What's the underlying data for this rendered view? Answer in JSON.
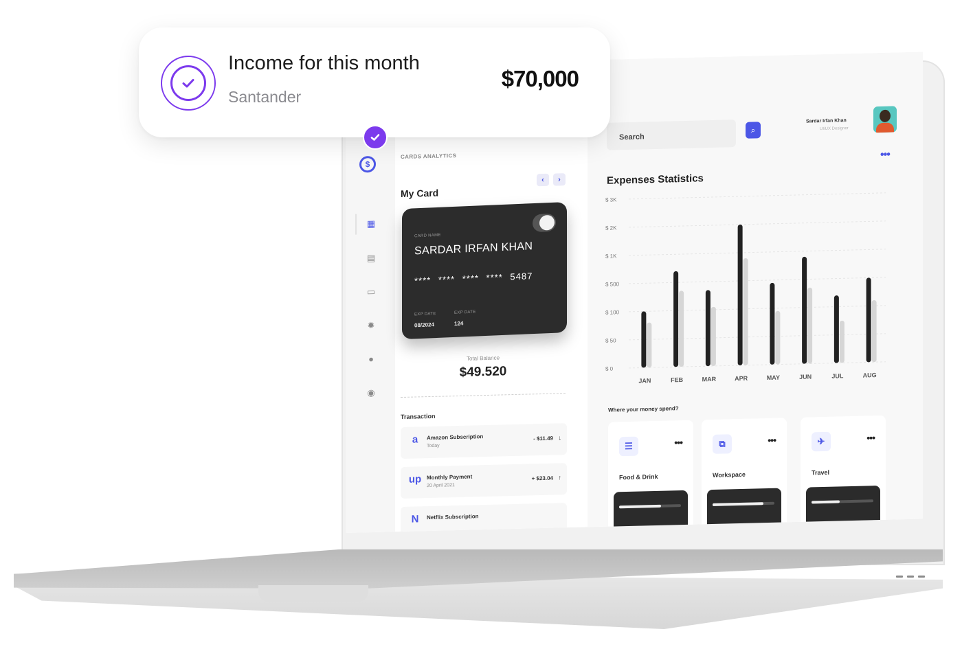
{
  "income_card": {
    "title": "Income for this month",
    "bank": "Santander",
    "amount": "$70,000"
  },
  "sidebar": {
    "icons": [
      "dashboard-icon",
      "calendar-icon",
      "chat-icon",
      "settings-icon",
      "user-icon",
      "help-icon"
    ]
  },
  "cards": {
    "section_label": "CARDS ANALYTICS",
    "title": "My Card",
    "prev": "‹",
    "next": "›",
    "card": {
      "name_label": "CARD NAME",
      "holder": "SARDAR IRFAN KHAN",
      "number": "**** **** **** **** 5487",
      "exp_label": "EXP DATE",
      "exp_value": "08/2024",
      "cvv_label": "EXP DATE",
      "cvv_value": "124"
    },
    "balance_label": "Total Balance",
    "balance_value": "$49.520"
  },
  "transactions": {
    "label": "Transaction",
    "items": [
      {
        "icon": "a",
        "title": "Amazon Subscription",
        "sub": "Today",
        "amount": "- $11.49",
        "direction": "↓"
      },
      {
        "icon": "up",
        "title": "Monthly Payment",
        "sub": "20 April 2021",
        "amount": "+ $23.04",
        "direction": "↑"
      },
      {
        "icon": "N",
        "title": "Netflix Subscription",
        "sub": "",
        "amount": "",
        "direction": ""
      }
    ]
  },
  "header": {
    "search_placeholder": "Search",
    "user_name": "Sardar Irfan Khan",
    "user_role": "UI/UX Designer"
  },
  "expenses": {
    "title": "Expenses Statistics",
    "where_label": "Where your money spend?"
  },
  "chart_data": {
    "type": "bar",
    "categories": [
      "JAN",
      "FEB",
      "MAR",
      "APR",
      "MAY",
      "JUN",
      "JUL",
      "AUG"
    ],
    "y_tick_labels": [
      "$ 0",
      "$ 50",
      "$ 100",
      "$ 500",
      "$ 1K",
      "$ 2K",
      "$ 3K"
    ],
    "series": [
      {
        "values": [
          2.0,
          3.4,
          2.7,
          5.0,
          2.9,
          3.8,
          2.4,
          3.0
        ]
      },
      {
        "values": [
          1.6,
          2.7,
          2.1,
          3.8,
          1.9,
          2.7,
          1.5,
          2.2
        ]
      }
    ],
    "ylim": [
      0,
      6
    ],
    "colors": [
      "#222222",
      "#d6d6d6"
    ],
    "grid": true
  },
  "categories": [
    {
      "icon": "☰",
      "label": "Food & Drink",
      "progress": 0.68
    },
    {
      "icon": "⧉",
      "label": "Workspace",
      "progress": 0.82
    },
    {
      "icon": "✈",
      "label": "Travel",
      "progress": 0.46
    }
  ],
  "colors": {
    "accent": "#4c57e6",
    "purple": "#7c3aed",
    "card": "#2c2c2c"
  }
}
